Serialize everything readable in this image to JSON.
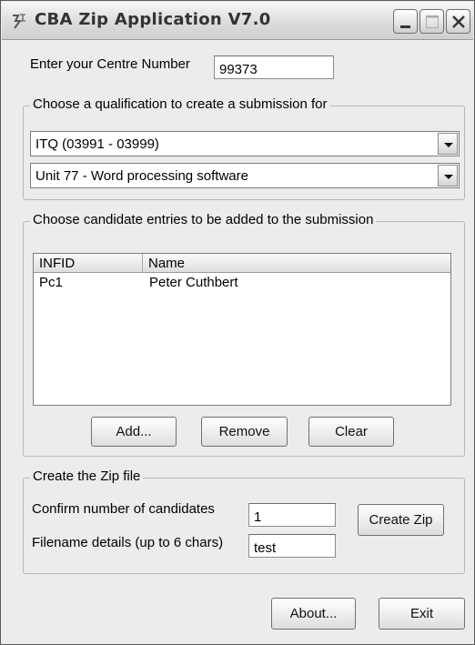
{
  "window": {
    "title": "CBA Zip Application V7.0"
  },
  "centre": {
    "label": "Enter your Centre Number",
    "value": "99373"
  },
  "qualification": {
    "legend": "Choose a qualification to create a submission for",
    "qualification_selected": "ITQ (03991 - 03999)",
    "unit_selected": "Unit 77 - Word processing software"
  },
  "candidates": {
    "legend": "Choose candidate entries to be added to the submission",
    "columns": [
      "INFID",
      "Name"
    ],
    "rows": [
      {
        "infid": "Pc1",
        "name": "Peter Cuthbert"
      }
    ],
    "add_label": "Add...",
    "remove_label": "Remove",
    "clear_label": "Clear"
  },
  "zip": {
    "legend": "Create the Zip file",
    "confirm_label": "Confirm number of candidates",
    "confirm_value": "1",
    "filename_label": "Filename details (up to 6 chars)",
    "filename_value": "test",
    "create_label": "Create Zip"
  },
  "footer": {
    "about_label": "About...",
    "exit_label": "Exit"
  }
}
